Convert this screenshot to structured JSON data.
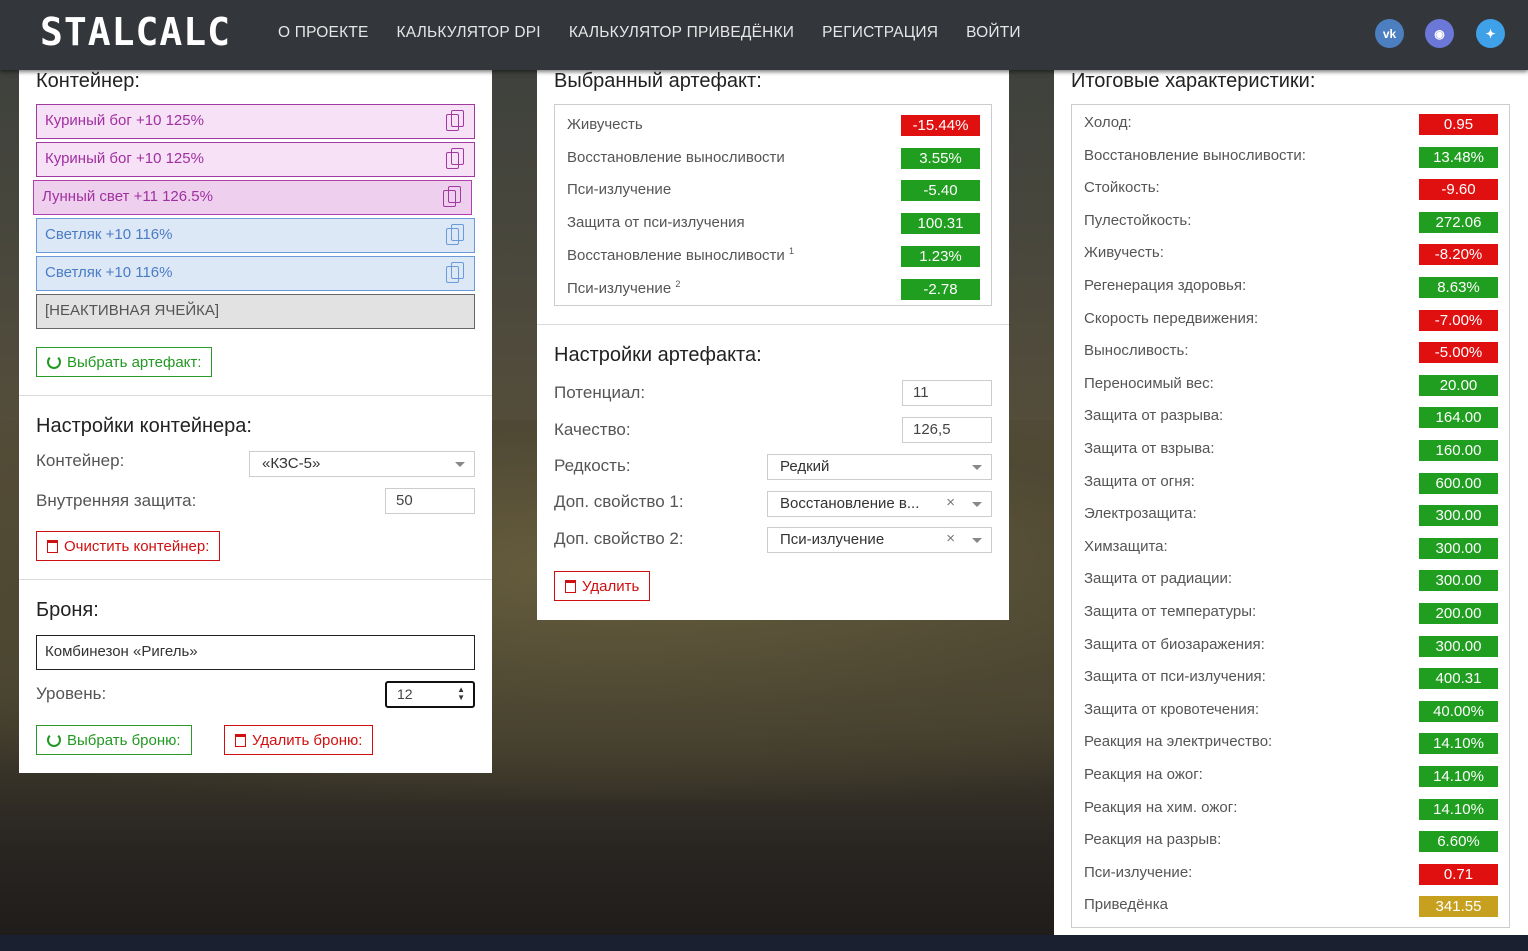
{
  "header": {
    "logo": "STALCALC",
    "nav": [
      "О ПРОЕКТЕ",
      "КАЛЬКУЛЯТОР DPI",
      "КАЛЬКУЛЯТОР ПРИВЕДЁНКИ",
      "РЕГИСТРАЦИЯ",
      "ВОЙТИ"
    ],
    "social": [
      "vk-icon",
      "discord-icon",
      "twitter-icon"
    ]
  },
  "container": {
    "title": "Контейнер:",
    "slots": [
      {
        "label": "Куриный бог +10 125%"
      },
      {
        "label": "Куриный бог +10 125%"
      },
      {
        "label": "Лунный свет +11 126.5%"
      },
      {
        "label": "Светляк +10 116%"
      },
      {
        "label": "Светляк +10 116%"
      },
      {
        "label": "[НЕАКТИВНАЯ ЯЧЕЙКА]"
      }
    ],
    "select_button": "Выбрать артефакт:"
  },
  "container_settings": {
    "title": "Настройки контейнера:",
    "container_label": "Контейнер:",
    "container_value": "«КЗС-5»",
    "inner_protection_label": "Внутренняя защита:",
    "inner_protection_value": "50",
    "clear_button": "Очистить контейнер:"
  },
  "armor": {
    "title": "Броня:",
    "name": "Комбинезон «Ригель»",
    "level_label": "Уровень:",
    "level_value": "12",
    "select_button": "Выбрать броню:",
    "delete_button": "Удалить броню:"
  },
  "selected_artifact": {
    "title": "Выбранный артефакт:",
    "stats": [
      {
        "name": "Живучесть",
        "sup": "",
        "value": "-15.44%",
        "color": "r"
      },
      {
        "name": "Восстановление выносливости",
        "sup": "",
        "value": "3.55%",
        "color": "g"
      },
      {
        "name": "Пси-излучение",
        "sup": "",
        "value": "-5.40",
        "color": "g"
      },
      {
        "name": "Защита от пси-излучения",
        "sup": "",
        "value": "100.31",
        "color": "g"
      },
      {
        "name": "Восстановление выносливости",
        "sup": "1",
        "value": "1.23%",
        "color": "g"
      },
      {
        "name": "Пси-излучение",
        "sup": "2",
        "value": "-2.78",
        "color": "g"
      }
    ]
  },
  "artifact_settings": {
    "title": "Настройки артефакта:",
    "potential_label": "Потенциал:",
    "potential_value": "11",
    "quality_label": "Качество:",
    "quality_value": "126,5",
    "rarity_label": "Редкость:",
    "rarity_value": "Редкий",
    "prop1_label": "Доп. свойство 1:",
    "prop1_value": "Восстановление в...",
    "prop2_label": "Доп. свойство 2:",
    "prop2_value": "Пси-излучение",
    "clear_x": "×",
    "delete_button": "Удалить"
  },
  "totals": {
    "title": "Итоговые характеристики:",
    "stats": [
      {
        "name": "Холод:",
        "value": "0.95",
        "color": "r"
      },
      {
        "name": "Восстановление выносливости:",
        "value": "13.48%",
        "color": "g"
      },
      {
        "name": "Стойкость:",
        "value": "-9.60",
        "color": "r"
      },
      {
        "name": "Пулестойкость:",
        "value": "272.06",
        "color": "g"
      },
      {
        "name": "Живучесть:",
        "value": "-8.20%",
        "color": "r"
      },
      {
        "name": "Регенерация здоровья:",
        "value": "8.63%",
        "color": "g"
      },
      {
        "name": "Скорость передвижения:",
        "value": "-7.00%",
        "color": "r"
      },
      {
        "name": "Выносливость:",
        "value": "-5.00%",
        "color": "r"
      },
      {
        "name": "Переносимый вес:",
        "value": "20.00",
        "color": "g"
      },
      {
        "name": "Защита от разрыва:",
        "value": "164.00",
        "color": "g"
      },
      {
        "name": "Защита от взрыва:",
        "value": "160.00",
        "color": "g"
      },
      {
        "name": "Защита от огня:",
        "value": "600.00",
        "color": "g"
      },
      {
        "name": "Электрозащита:",
        "value": "300.00",
        "color": "g"
      },
      {
        "name": "Химзащита:",
        "value": "300.00",
        "color": "g"
      },
      {
        "name": "Защита от радиации:",
        "value": "300.00",
        "color": "g"
      },
      {
        "name": "Защита от температуры:",
        "value": "200.00",
        "color": "g"
      },
      {
        "name": "Защита от биозаражения:",
        "value": "300.00",
        "color": "g"
      },
      {
        "name": "Защита от пси-излучения:",
        "value": "400.31",
        "color": "g"
      },
      {
        "name": "Защита от кровотечения:",
        "value": "40.00%",
        "color": "g"
      },
      {
        "name": "Реакция на электричество:",
        "value": "14.10%",
        "color": "g"
      },
      {
        "name": "Реакция на ожог:",
        "value": "14.10%",
        "color": "g"
      },
      {
        "name": "Реакция на хим. ожог:",
        "value": "14.10%",
        "color": "g"
      },
      {
        "name": "Реакция на разрыв:",
        "value": "6.60%",
        "color": "g"
      },
      {
        "name": "Пси-излучение:",
        "value": "0.71",
        "color": "r"
      },
      {
        "name": "Приведёнка",
        "value": "341.55",
        "color": "y"
      }
    ]
  }
}
